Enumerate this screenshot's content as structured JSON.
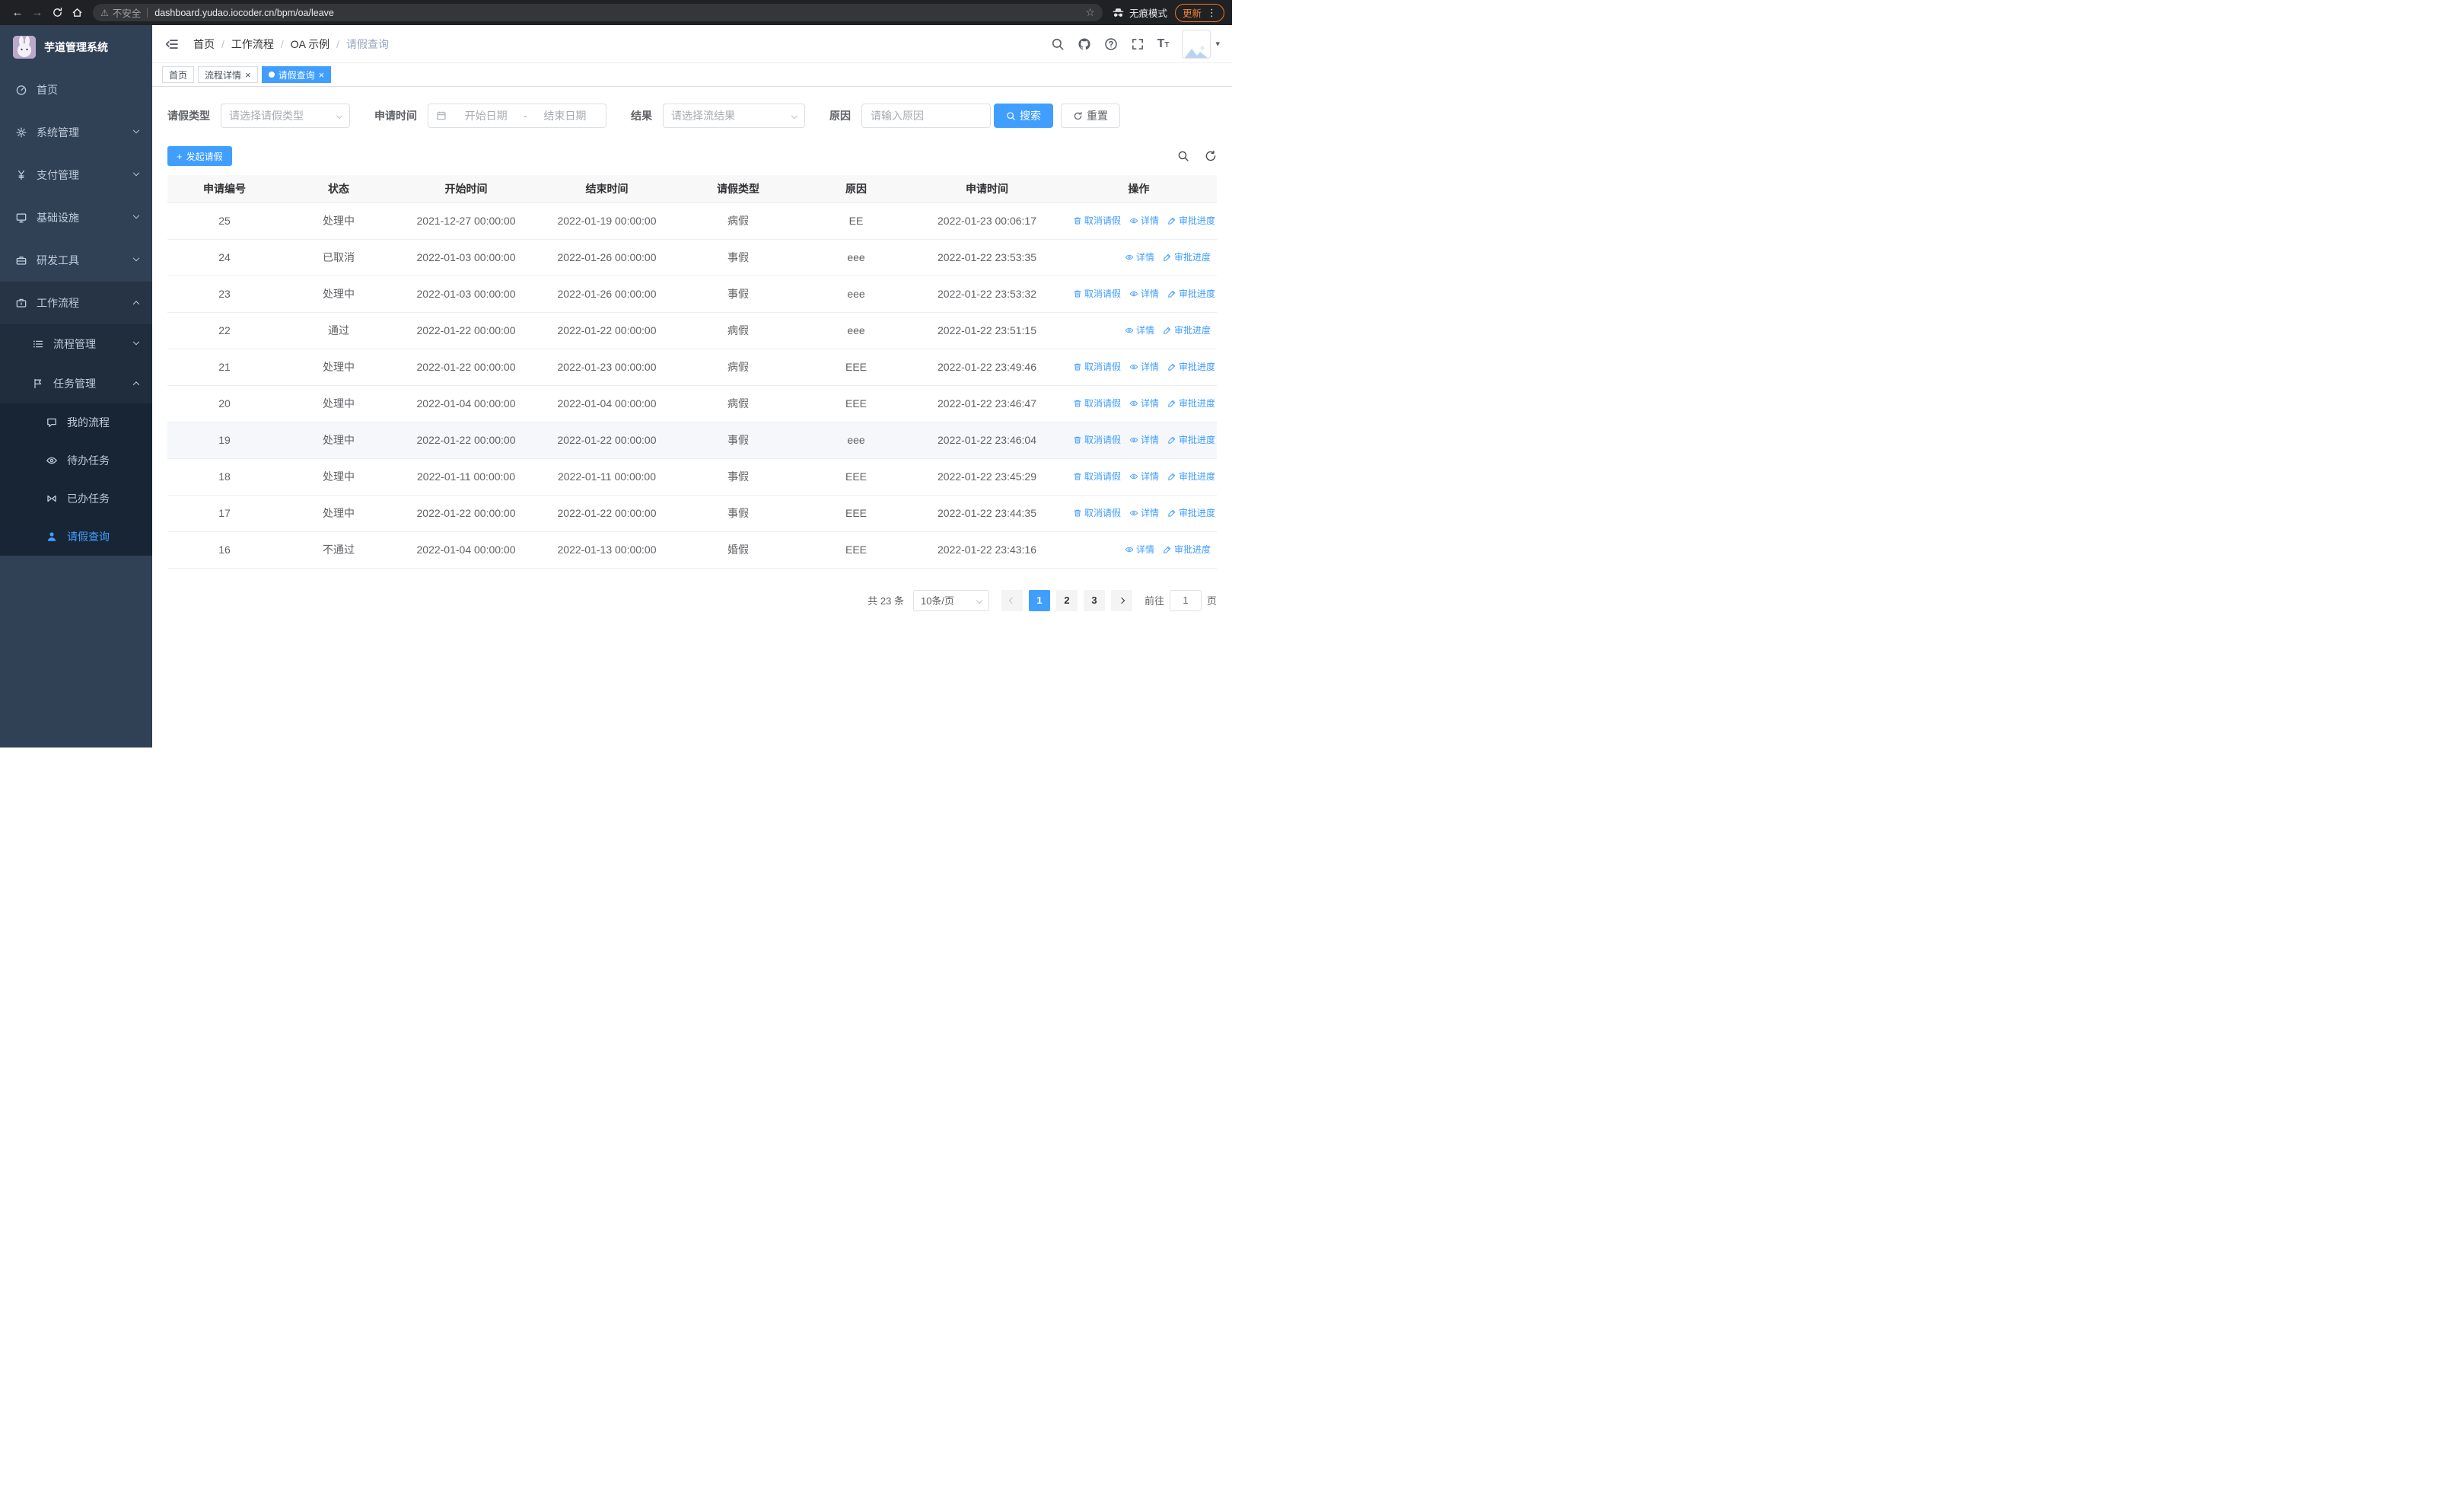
{
  "browser": {
    "url": "dashboard.yudao.iocoder.cn/bpm/oa/leave",
    "security_warning": "不安全",
    "incognito_label": "无痕模式",
    "update_label": "更新"
  },
  "icons": {
    "back": "←",
    "forward": "→",
    "star": "☆",
    "kebab": "⋮",
    "warning": "⚠",
    "close": "×",
    "plus": "+",
    "caret_down": "▾",
    "breadcrumb_separator": "/",
    "text_large": "T",
    "text_small": "T"
  },
  "sidebar": {
    "logo_title": "芋道管理系统",
    "items": [
      {
        "label": "首页"
      },
      {
        "label": "系统管理"
      },
      {
        "label": "支付管理"
      },
      {
        "label": "基础设施"
      },
      {
        "label": "研发工具"
      },
      {
        "label": "工作流程"
      }
    ],
    "workflow_children": [
      {
        "label": "流程管理"
      },
      {
        "label": "任务管理"
      }
    ],
    "task_children": [
      {
        "label": "我的流程"
      },
      {
        "label": "待办任务"
      },
      {
        "label": "已办任务"
      },
      {
        "label": "请假查询"
      }
    ]
  },
  "breadcrumb": [
    "首页",
    "工作流程",
    "OA 示例",
    "请假查询"
  ],
  "tabs": [
    {
      "label": "首页"
    },
    {
      "label": "流程详情"
    },
    {
      "label": "请假查询"
    }
  ],
  "filters": {
    "leave_type_label": "请假类型",
    "leave_type_placeholder": "请选择请假类型",
    "apply_time_label": "申请时间",
    "start_date_placeholder": "开始日期",
    "end_date_placeholder": "结束日期",
    "range_separator": "-",
    "result_label": "结果",
    "result_placeholder": "请选择流结果",
    "reason_label": "原因",
    "reason_placeholder": "请输入原因",
    "search_label": "搜索",
    "reset_label": "重置"
  },
  "toolbar": {
    "create_label": "发起请假"
  },
  "table": {
    "columns": [
      "申请编号",
      "状态",
      "开始时间",
      "结束时间",
      "请假类型",
      "原因",
      "申请时间",
      "操作"
    ],
    "action_labels": {
      "cancel": "取消请假",
      "detail": "详情",
      "progress": "审批进度"
    },
    "rows": [
      {
        "id": "25",
        "status": "处理中",
        "start": "2021-12-27 00:00:00",
        "end": "2022-01-19 00:00:00",
        "type": "病假",
        "reason": "EE",
        "apply_time": "2022-01-23 00:06:17",
        "actions": [
          "cancel",
          "detail",
          "progress"
        ]
      },
      {
        "id": "24",
        "status": "已取消",
        "start": "2022-01-03 00:00:00",
        "end": "2022-01-26 00:00:00",
        "type": "事假",
        "reason": "eee",
        "apply_time": "2022-01-22 23:53:35",
        "actions": [
          "detail",
          "progress"
        ]
      },
      {
        "id": "23",
        "status": "处理中",
        "start": "2022-01-03 00:00:00",
        "end": "2022-01-26 00:00:00",
        "type": "事假",
        "reason": "eee",
        "apply_time": "2022-01-22 23:53:32",
        "actions": [
          "cancel",
          "detail",
          "progress"
        ]
      },
      {
        "id": "22",
        "status": "通过",
        "start": "2022-01-22 00:00:00",
        "end": "2022-01-22 00:00:00",
        "type": "病假",
        "reason": "eee",
        "apply_time": "2022-01-22 23:51:15",
        "actions": [
          "detail",
          "progress"
        ]
      },
      {
        "id": "21",
        "status": "处理中",
        "start": "2022-01-22 00:00:00",
        "end": "2022-01-23 00:00:00",
        "type": "病假",
        "reason": "EEE",
        "apply_time": "2022-01-22 23:49:46",
        "actions": [
          "cancel",
          "detail",
          "progress"
        ]
      },
      {
        "id": "20",
        "status": "处理中",
        "start": "2022-01-04 00:00:00",
        "end": "2022-01-04 00:00:00",
        "type": "病假",
        "reason": "EEE",
        "apply_time": "2022-01-22 23:46:47",
        "actions": [
          "cancel",
          "detail",
          "progress"
        ]
      },
      {
        "id": "19",
        "status": "处理中",
        "start": "2022-01-22 00:00:00",
        "end": "2022-01-22 00:00:00",
        "type": "事假",
        "reason": "eee",
        "apply_time": "2022-01-22 23:46:04",
        "actions": [
          "cancel",
          "detail",
          "progress"
        ],
        "hover": true
      },
      {
        "id": "18",
        "status": "处理中",
        "start": "2022-01-11 00:00:00",
        "end": "2022-01-11 00:00:00",
        "type": "事假",
        "reason": "EEE",
        "apply_time": "2022-01-22 23:45:29",
        "actions": [
          "cancel",
          "detail",
          "progress"
        ]
      },
      {
        "id": "17",
        "status": "处理中",
        "start": "2022-01-22 00:00:00",
        "end": "2022-01-22 00:00:00",
        "type": "事假",
        "reason": "EEE",
        "apply_time": "2022-01-22 23:44:35",
        "actions": [
          "cancel",
          "detail",
          "progress"
        ]
      },
      {
        "id": "16",
        "status": "不通过",
        "start": "2022-01-04 00:00:00",
        "end": "2022-01-13 00:00:00",
        "type": "婚假",
        "reason": "EEE",
        "apply_time": "2022-01-22 23:43:16",
        "actions": [
          "detail",
          "progress"
        ]
      }
    ]
  },
  "pagination": {
    "total_text": "共 23 条",
    "page_size": "10条/页",
    "pages": [
      "1",
      "2",
      "3"
    ],
    "goto_prefix": "前往",
    "goto_value": "1",
    "goto_suffix": "页"
  },
  "colors": {
    "primary": "#409eff",
    "sidebar_bg": "#304156",
    "sidebar_sub_bg": "#1f2d3d",
    "tab_active_bg": "#409eff",
    "update_pill": "#ee7624"
  }
}
